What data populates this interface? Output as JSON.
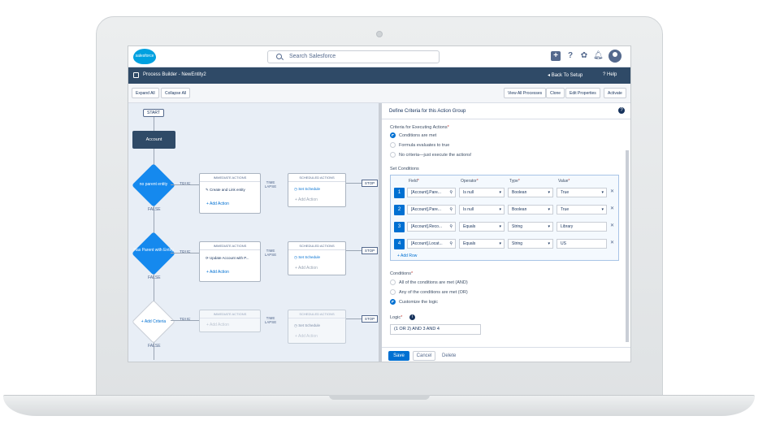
{
  "header": {
    "logo_text": "salesforce",
    "search_placeholder": "Search Salesforce",
    "icons": [
      "add-icon",
      "help-icon",
      "setup-icon",
      "bell-icon",
      "avatar"
    ]
  },
  "builder_bar": {
    "title": "Process Builder - NewEntity2",
    "back_to_setup": "Back To Setup",
    "help": "Help"
  },
  "toolbar": {
    "expand_all": "Expand All",
    "collapse_all": "Collapse All",
    "view_all_processes": "View All Processes",
    "clone": "Clone",
    "edit_properties": "Edit Properties",
    "activate": "Activate"
  },
  "canvas": {
    "start": "START",
    "object": "Account",
    "true_label": "TRUE",
    "false_label": "FALSE",
    "time_lapse": "TIME LAPSE",
    "stop": "STOP",
    "criteria": [
      {
        "label": "no parent entity",
        "immediate_title": "IMMEDIATE ACTIONS",
        "immediate_item": "Create and Link entity",
        "add_action": "Add Action",
        "scheduled_title": "SCHEDULED ACTIONS",
        "set_schedule": "Set Schedule",
        "scheduled_add": "Add Action"
      },
      {
        "label": "Has Parent with Entity",
        "immediate_title": "IMMEDIATE ACTIONS",
        "immediate_item": "Update Account with P...",
        "add_action": "Add Action",
        "scheduled_title": "SCHEDULED ACTIONS",
        "set_schedule": "Set Schedule",
        "scheduled_add": "Add Action"
      },
      {
        "label": "Add Criteria",
        "immediate_title": "IMMEDIATE ACTIONS",
        "add_action": "Add Action",
        "scheduled_title": "SCHEDULED ACTIONS",
        "set_schedule": "Set Schedule",
        "scheduled_add": "Add Action"
      }
    ]
  },
  "panel": {
    "title": "Define Criteria for this Action Group",
    "criteria_label": "Criteria for Executing Actions",
    "criteria_options": [
      "Conditions are met",
      "Formula evaluates to true",
      "No criteria—just execute the actions!"
    ],
    "criteria_selected": 0,
    "set_conditions": "Set Conditions",
    "columns": [
      "Field",
      "Operator",
      "Type",
      "Value"
    ],
    "rows": [
      {
        "num": "1",
        "field": "[Account].Pare...",
        "operator": "Is null",
        "type": "Boolean",
        "value": "True"
      },
      {
        "num": "2",
        "field": "[Account].Pare...",
        "operator": "Is null",
        "type": "Boolean",
        "value": "True"
      },
      {
        "num": "3",
        "field": "[Account].Reco...",
        "operator": "Equals",
        "type": "String",
        "value": "Library"
      },
      {
        "num": "4",
        "field": "[Account].Locat...",
        "operator": "Equals",
        "type": "String",
        "value": "US"
      }
    ],
    "add_row": "Add Row",
    "conditions_label": "Conditions",
    "conditions_options": [
      "All of the conditions are met (AND)",
      "Any of the conditions are met (OR)",
      "Customize the logic"
    ],
    "conditions_selected": 2,
    "logic_label": "Logic",
    "logic_value": "(1 OR 2) AND 3 AND 4",
    "save": "Save",
    "cancel": "Cancel",
    "delete": "Delete"
  },
  "colors": {
    "brand": "#00a1e0",
    "header_bar": "#2f4a67",
    "accent": "#0070d2",
    "canvas_bg": "#e8eef6"
  }
}
